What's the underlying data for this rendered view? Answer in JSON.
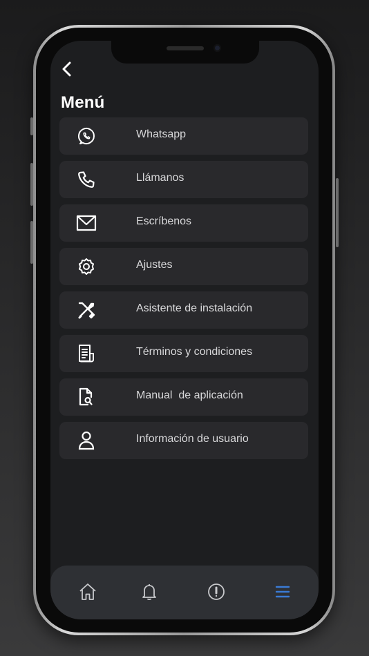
{
  "header": {
    "back_icon": "chevron-left-icon",
    "title": "Menú"
  },
  "menu": {
    "items": [
      {
        "label": "Whatsapp",
        "icon": "whatsapp-icon"
      },
      {
        "label": "Llámanos",
        "icon": "phone-icon"
      },
      {
        "label": "Escríbenos",
        "icon": "mail-icon"
      },
      {
        "label": "Ajustes",
        "icon": "gear-icon"
      },
      {
        "label": "Asistente de instalación",
        "icon": "tools-icon"
      },
      {
        "label": "Términos y condiciones",
        "icon": "document-icon"
      },
      {
        "label": "Manual  de aplicación",
        "icon": "document-search-icon"
      },
      {
        "label": "Información de usuario",
        "icon": "user-icon"
      }
    ]
  },
  "bottom_nav": {
    "items": [
      {
        "icon": "home-icon",
        "active": false
      },
      {
        "icon": "bell-icon",
        "active": false
      },
      {
        "icon": "alert-icon",
        "active": false
      },
      {
        "icon": "menu-icon",
        "active": true
      }
    ]
  },
  "colors": {
    "screen_bg": "#1d1e20",
    "card_bg": "#29292c",
    "text": "#d8d8da",
    "accent": "#3a7bd5",
    "nav_bg": "#2e3034"
  }
}
